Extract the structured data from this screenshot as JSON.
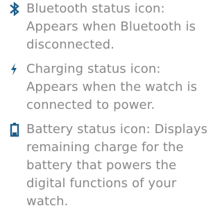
{
  "items": [
    {
      "icon": "bluetooth-icon",
      "text": "Bluetooth status icon: Appears when Bluetooth is disconnected."
    },
    {
      "icon": "lightning-bolt-icon",
      "text": "Charging status icon: Appears when the watch is connected to power."
    },
    {
      "icon": "battery-icon",
      "text": "Battery status icon: Displays remaining charge for the battery that powers the digital functions of your watch."
    }
  ],
  "colors": {
    "text": "#888888",
    "icon": "#1d5d8a"
  }
}
